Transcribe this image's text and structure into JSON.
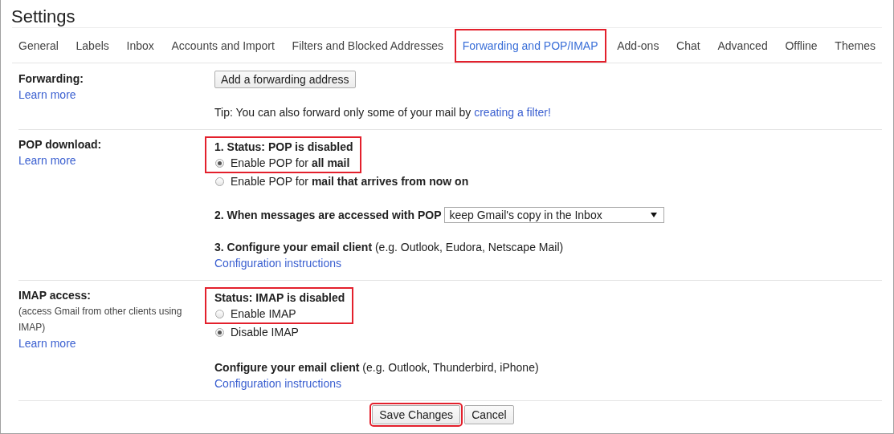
{
  "window": {
    "title": "Settings"
  },
  "tabs": [
    {
      "label": "General",
      "selected": false,
      "highlighted": false
    },
    {
      "label": "Labels",
      "selected": false,
      "highlighted": false
    },
    {
      "label": "Inbox",
      "selected": false,
      "highlighted": false
    },
    {
      "label": "Accounts and Import",
      "selected": false,
      "highlighted": false
    },
    {
      "label": "Filters and Blocked Addresses",
      "selected": false,
      "highlighted": false
    },
    {
      "label": "Forwarding and POP/IMAP",
      "selected": true,
      "highlighted": true
    },
    {
      "label": "Add-ons",
      "selected": false,
      "highlighted": false
    },
    {
      "label": "Chat",
      "selected": false,
      "highlighted": false
    },
    {
      "label": "Advanced",
      "selected": false,
      "highlighted": false
    },
    {
      "label": "Offline",
      "selected": false,
      "highlighted": false
    },
    {
      "label": "Themes",
      "selected": false,
      "highlighted": false
    }
  ],
  "sections": [
    {
      "kind": "forwarding",
      "label": "Forwarding:",
      "learn_more": "Learn more",
      "button": "Add a forwarding address",
      "tip": "Tip: You can also forward only some of your mail by",
      "tip_link": "creating a filter!"
    },
    {
      "kind": "pop",
      "label": "POP download:",
      "learn_more": "Learn more",
      "status": "1. Status: POP is disabled",
      "highlighted": true,
      "options": [
        {
          "label": "Enable POP for **all mail**",
          "selected": true
        },
        {
          "label": "Enable POP for **mail that arrives from now on**",
          "selected": false
        }
      ],
      "when": "2. When messages are accessed with POP",
      "when_value": "keep Gmail's copy in the Inbox",
      "configure": "**3. Configure your email client** (e.g. Outlook, Eudora, Netscape Mail)",
      "config_link": "Configuration instructions"
    },
    {
      "kind": "imap",
      "label": "IMAP access:",
      "note": "(access Gmail from other clients using IMAP)",
      "learn_more": "Learn more",
      "status": "Status: IMAP is disabled",
      "highlighted": true,
      "options": [
        {
          "label": "Enable IMAP",
          "selected": false
        },
        {
          "label": "Disable IMAP",
          "selected": true
        }
      ],
      "configure": "**Configure your email client** (e.g. Outlook, Thunderbird, iPhone)",
      "config_link": "Configuration instructions"
    }
  ],
  "buttons": [
    {
      "label": "Save Changes",
      "highlighted": true
    },
    {
      "label": "Cancel",
      "highlighted": false
    }
  ]
}
